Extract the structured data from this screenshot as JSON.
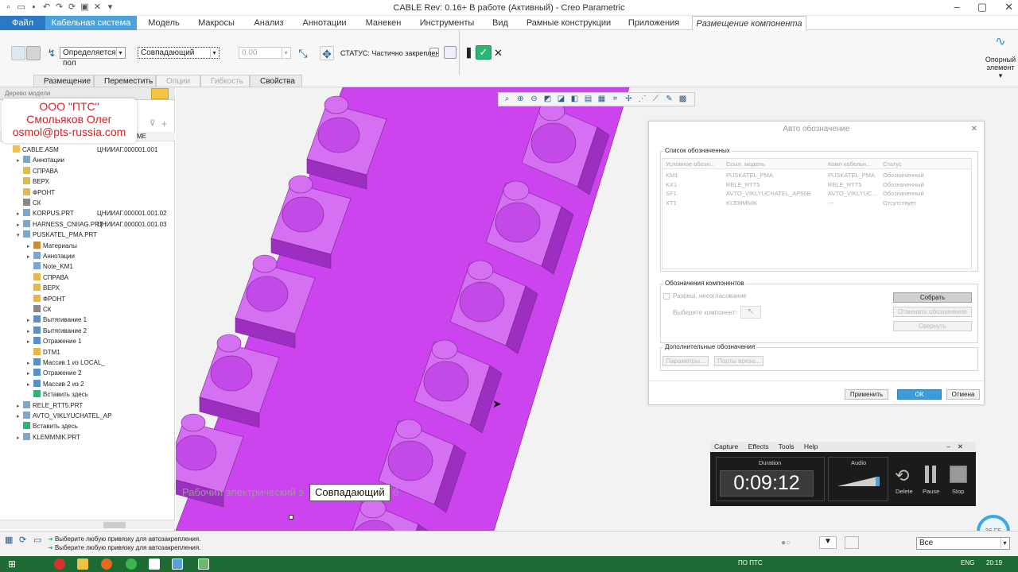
{
  "window": {
    "title": "CABLE Rev: 0.16+ В работе  (Активный) - Creo Parametric"
  },
  "tabs": [
    {
      "label": "Файл"
    },
    {
      "label": "Кабельная система"
    },
    {
      "label": "Модель"
    },
    {
      "label": "Макросы"
    },
    {
      "label": "Анализ"
    },
    {
      "label": "Аннотации"
    },
    {
      "label": "Манекен"
    },
    {
      "label": "Инструменты"
    },
    {
      "label": "Вид"
    },
    {
      "label": "Рамные конструкции"
    },
    {
      "label": "Приложения"
    },
    {
      "label": "Размещение компонента"
    }
  ],
  "ribbon": {
    "constraint_mode": "Определяется пол",
    "constraint_type": "Совпадающий",
    "offset_value": "0.00",
    "status": "СТАТУС: Частично закреплен",
    "datum_label_1": "Опорный",
    "datum_label_2": "элемент",
    "subtabs": [
      "Размещение",
      "Переместить",
      "Опции",
      "Гибкость",
      "Свойства"
    ]
  },
  "tree": {
    "header_tab": "Дерево модели",
    "col_name": "МЕ",
    "rows": [
      {
        "label": "CABLE.ASM",
        "note": "ЦНИИАГ.000001.001"
      },
      {
        "label": "Аннотации",
        "note": ""
      },
      {
        "label": "СПРАВА",
        "note": ""
      },
      {
        "label": "ВЕРХ",
        "note": ""
      },
      {
        "label": "ФРОНТ",
        "note": ""
      },
      {
        "label": "СК",
        "note": ""
      },
      {
        "label": "KORPUS.PRT",
        "note": "ЦНИИАГ.000001.001.02"
      },
      {
        "label": "HARNESS_CNIIAG.PRT",
        "note": "ЦНИИАГ.000001.001.03"
      },
      {
        "label": "PUSKATEL_PMA.PRT",
        "note": ""
      },
      {
        "label": "Материалы",
        "note": ""
      },
      {
        "label": "Аннотации",
        "note": ""
      },
      {
        "label": "Note_KM1",
        "note": ""
      },
      {
        "label": "СПРАВА",
        "note": ""
      },
      {
        "label": "ВЕРХ",
        "note": ""
      },
      {
        "label": "ФРОНТ",
        "note": ""
      },
      {
        "label": "СК",
        "note": ""
      },
      {
        "label": "Вытягивание 1",
        "note": ""
      },
      {
        "label": "Вытягивание 2",
        "note": ""
      },
      {
        "label": "Отражение 1",
        "note": ""
      },
      {
        "label": "DTM1",
        "note": ""
      },
      {
        "label": "Массив 1 из LOCAL_",
        "note": ""
      },
      {
        "label": "Отражение 2",
        "note": ""
      },
      {
        "label": "Массив 2 из 2",
        "note": ""
      },
      {
        "label": "Вставить здесь",
        "note": ""
      },
      {
        "label": "RELE_RTT5.PRT",
        "note": ""
      },
      {
        "label": "AVTO_VIKLYUCHATEL_AP",
        "note": ""
      },
      {
        "label": "Вставить здесь",
        "note": ""
      },
      {
        "label": "KLEMMNIK.PRT",
        "note": ""
      }
    ]
  },
  "watermark": {
    "line1": "ООО \"ПТС\"",
    "line2": "Смольяков Олег",
    "line3": "osmol@pts-russia.com"
  },
  "viewport": {
    "model_label": "Рабочий электрический э",
    "model_label_tail": "б",
    "tooltip": "Совпадающий"
  },
  "dialog": {
    "title": "Авто обозначение",
    "group_list": "Список обозначенных",
    "columns": [
      "Условное обозн...",
      "Ссыл. модель",
      "Комп кабельн...",
      "Статус"
    ],
    "rows": [
      [
        "KM1",
        "PUSKATEL_PMA",
        "PUSKATEL_PMA",
        "Обозначенный"
      ],
      [
        "KX1",
        "RELE_RTT5",
        "RELE_RTT5",
        "Обозначенный"
      ],
      [
        "SF1",
        "AVTO_VIKLYUCHATEL_AP50B",
        "AVTO_VIKLYUC...",
        "Обозначенный"
      ],
      [
        "XT1",
        "KLEMMNIK",
        "---",
        "Отсутствует"
      ]
    ],
    "group_components": "Обозначения компонентов",
    "allow_mismatch": "Разреш. несогласование",
    "select_component": "Выберите компонент:",
    "btn_collect": "Собрать",
    "btn_cancel_designation": "Отменить обозначение",
    "btn_collapse": "Свернуть",
    "group_extra": "Дополнительные обозначения",
    "btn_params": "Параметры...",
    "btn_ports": "Порты вреза...",
    "btn_apply": "Применить",
    "btn_ok": "ОК",
    "btn_cancel": "Отмена"
  },
  "recorder": {
    "menu": [
      "Capture",
      "Effects",
      "Tools",
      "Help"
    ],
    "duration_label": "Duration",
    "duration": "0:09:12",
    "audio_label": "Audio",
    "delete": "Delete",
    "pause": "Pause",
    "stop": "Stop"
  },
  "statusbar": {
    "msg1": "Выберите любую привязку для автозакрепления.",
    "msg2": "Выберите любую привязку для автозакрепления.",
    "filter": "Все"
  },
  "badge": "36 ГБ",
  "taskbar": {
    "tray_text": "ПО ПТС",
    "lang": "ENG",
    "time": "20:19"
  },
  "colors": {
    "model": "#cc44ee",
    "accent": "#3d9bd6",
    "file_tab": "#2b78c4",
    "taskbar": "#1e6a34"
  }
}
